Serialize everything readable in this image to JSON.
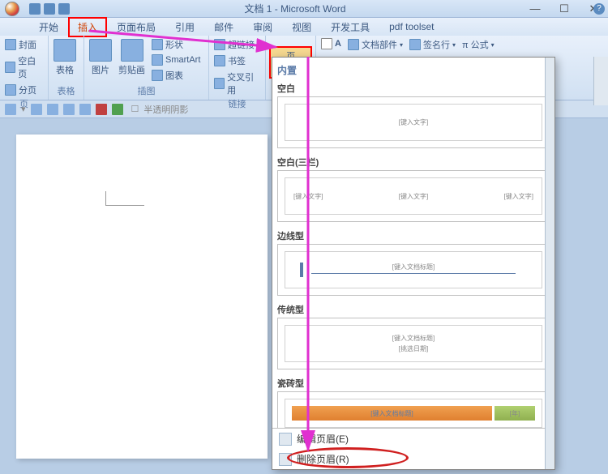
{
  "window": {
    "title": "文档 1 - Microsoft Word"
  },
  "tabs": {
    "home": "开始",
    "insert": "插入",
    "layout": "页面布局",
    "ref": "引用",
    "mail": "邮件",
    "review": "审阅",
    "view": "视图",
    "dev": "开发工具",
    "pdf": "pdf toolset"
  },
  "ribbon": {
    "pages": {
      "cover": "封面",
      "blank": "空白页",
      "break": "分页",
      "label": "页"
    },
    "tables": {
      "table": "表格",
      "label": "表格"
    },
    "illus": {
      "picture": "图片",
      "clipart": "剪贴画",
      "shapes": "形状",
      "smartart": "SmartArt",
      "chart": "图表",
      "label": "插图"
    },
    "links": {
      "hyperlink": "超链接",
      "bookmark": "书签",
      "crossref": "交叉引用",
      "label": "链接"
    },
    "headerfooter": {
      "header": "页眉"
    },
    "text": {
      "parts": "文档部件",
      "sig": "签名行",
      "formula": "π 公式"
    }
  },
  "secondary": {
    "shadow": "半透明阴影"
  },
  "panel": {
    "builtin": "内置",
    "blank": {
      "title": "空白",
      "placeholder": "[键入文字]"
    },
    "blank3": {
      "title": "空白(三栏)",
      "left": "[键入文字]",
      "mid": "[键入文字]",
      "right": "[键入文字]"
    },
    "border": {
      "title": "边线型",
      "placeholder": "[键入文档标题]"
    },
    "trad": {
      "title": "传统型",
      "line1": "[键入文档标题]",
      "line2": "[挑选日期]"
    },
    "brick": {
      "title": "瓷砖型",
      "main": "[键入文档标题]",
      "side": "[年]"
    },
    "edit": "编辑页眉(E)",
    "remove": "删除页眉(R)"
  }
}
